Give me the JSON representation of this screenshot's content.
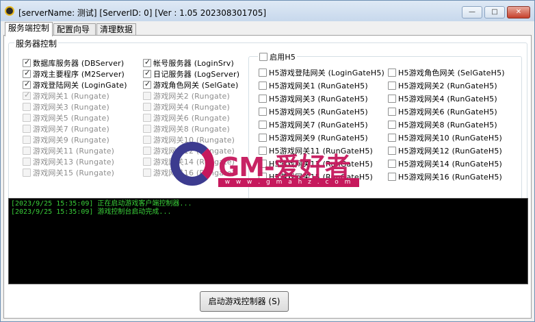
{
  "window": {
    "title": "[serverName: 测试] [ServerID: 0] [Ver : 1.05 202308301705]",
    "min_glyph": "—",
    "max_glyph": "□",
    "close_glyph": "✕"
  },
  "tabs": [
    "服务端控制",
    "配置向导",
    "清理数据"
  ],
  "group_title": "服务器控制",
  "left_col": [
    {
      "label": "数据库服务器 (DBServer)",
      "checked": true,
      "enabled": true
    },
    {
      "label": "游戏主要程序 (M2Server)",
      "checked": true,
      "enabled": true
    },
    {
      "label": "游戏登陆网关 (LoginGate)",
      "checked": true,
      "enabled": true
    },
    {
      "label": "游戏网关1 (Rungate)",
      "checked": true,
      "enabled": false
    },
    {
      "label": "游戏网关3 (Rungate)",
      "checked": false,
      "enabled": false
    },
    {
      "label": "游戏网关5 (Rungate)",
      "checked": false,
      "enabled": false
    },
    {
      "label": "游戏网关7 (Rungate)",
      "checked": false,
      "enabled": false
    },
    {
      "label": "游戏网关9 (Rungate)",
      "checked": false,
      "enabled": false
    },
    {
      "label": "游戏网关11 (Rungate)",
      "checked": false,
      "enabled": false
    },
    {
      "label": "游戏网关13 (Rungate)",
      "checked": false,
      "enabled": false
    },
    {
      "label": "游戏网关15 (Rungate)",
      "checked": false,
      "enabled": false
    }
  ],
  "mid_col": [
    {
      "label": "帐号服务器 (LoginSrv)",
      "checked": true,
      "enabled": true
    },
    {
      "label": "日记服务器 (LogServer)",
      "checked": true,
      "enabled": true
    },
    {
      "label": "游戏角色网关 (SelGate)",
      "checked": true,
      "enabled": true
    },
    {
      "label": "游戏网关2 (Rungate)",
      "checked": false,
      "enabled": false
    },
    {
      "label": "游戏网关4 (Rungate)",
      "checked": false,
      "enabled": false
    },
    {
      "label": "游戏网关6 (Rungate)",
      "checked": false,
      "enabled": false
    },
    {
      "label": "游戏网关8 (Rungate)",
      "checked": false,
      "enabled": false
    },
    {
      "label": "游戏网关10 (Rungate)",
      "checked": false,
      "enabled": false
    },
    {
      "label": "游戏网关12 (Rungate)",
      "checked": false,
      "enabled": false
    },
    {
      "label": "游戏网关14 (Rungate)",
      "checked": false,
      "enabled": false
    },
    {
      "label": "游戏网关16 (Rungate)",
      "checked": false,
      "enabled": false
    }
  ],
  "h5": {
    "enable_label": "启用H5",
    "enabled_checked": false,
    "left": [
      "H5游戏登陆网关 (LoginGateH5)",
      "H5游戏网关1 (RunGateH5)",
      "H5游戏网关3 (RunGateH5)",
      "H5游戏网关5 (RunGateH5)",
      "H5游戏网关7 (RunGateH5)",
      "H5游戏网关9 (RunGateH5)",
      "H5游戏网关11 (RunGateH5)",
      "H5游戏网关13 (RunGateH5)",
      "H5游戏网关15 (RunGateH5)"
    ],
    "right": [
      "H5游戏角色网关 (SelGateH5)",
      "H5游戏网关2 (RunGateH5)",
      "H5游戏网关4 (RunGateH5)",
      "H5游戏网关6 (RunGateH5)",
      "H5游戏网关8 (RunGateH5)",
      "H5游戏网关10 (RunGateH5)",
      "H5游戏网关12 (RunGateH5)",
      "H5游戏网关14 (RunGateH5)",
      "H5游戏网关16 (RunGateH5)"
    ]
  },
  "log": [
    "[2023/9/25 15:35:09] 正在启动游戏客户端控制器...",
    "[2023/9/25 15:35:09] 游戏控制台启动完成..."
  ],
  "start_button": "启动游戏控制器 (S)",
  "watermark": {
    "text": "GM-爱好者",
    "url": "w w w . g m a h z . c o m"
  },
  "colors": {
    "log_text": "#3ad03a",
    "watermark": "#c6185c",
    "watermark_g": "#3c3b8f"
  }
}
